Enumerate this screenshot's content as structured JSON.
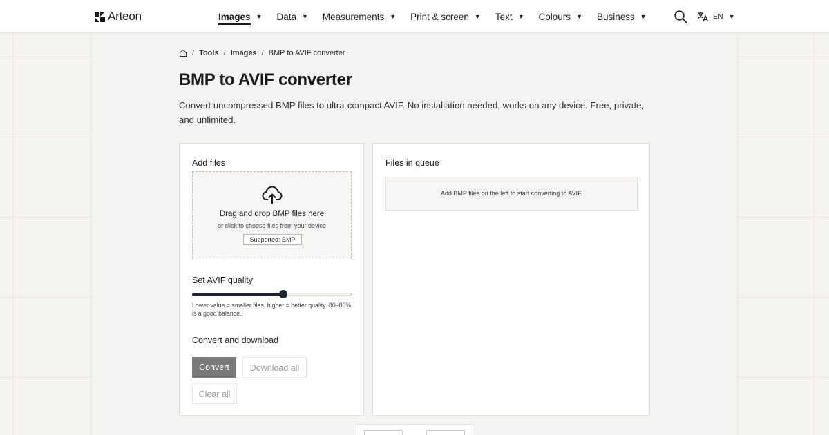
{
  "brand": {
    "name": "Arteon"
  },
  "nav": {
    "items": [
      {
        "label": "Images",
        "active": true
      },
      {
        "label": "Data"
      },
      {
        "label": "Measurements"
      },
      {
        "label": "Print & screen"
      },
      {
        "label": "Text"
      },
      {
        "label": "Colours"
      },
      {
        "label": "Business"
      }
    ],
    "caret": "▼"
  },
  "language": {
    "code": "EN",
    "caret": "▼"
  },
  "breadcrumb": {
    "sep": "/",
    "items": [
      "Tools",
      "Images",
      "BMP to AVIF converter"
    ]
  },
  "page": {
    "title": "BMP to AVIF converter",
    "description": "Convert uncompressed BMP files to ultra-compact AVIF. No installation needed, works on any device. Free, private, and unlimited."
  },
  "add_files": {
    "title": "Add files",
    "drop_title": "Drag and drop BMP files here",
    "drop_sub": "or click to choose files from your device",
    "supported": "Supported: BMP"
  },
  "quality": {
    "title": "Set AVIF quality",
    "value": 0.57,
    "help": "Lower value = smaller files, higher = better quality. 80–85% is a good balance."
  },
  "actions": {
    "title": "Convert and download",
    "convert": "Convert",
    "download_all": "Download all",
    "clear_all": "Clear all"
  },
  "queue": {
    "title": "Files in queue",
    "empty": "Add BMP files on the left to start converting to AVIF."
  },
  "icons": {
    "logo": "arteon-logo-icon",
    "search": "search-icon",
    "language": "translate-icon",
    "home": "home-icon",
    "upload": "cloud-upload-icon"
  },
  "colors": {
    "primary_button": "#797878",
    "slider": "#1d2433",
    "background": "#f6f4f1"
  }
}
